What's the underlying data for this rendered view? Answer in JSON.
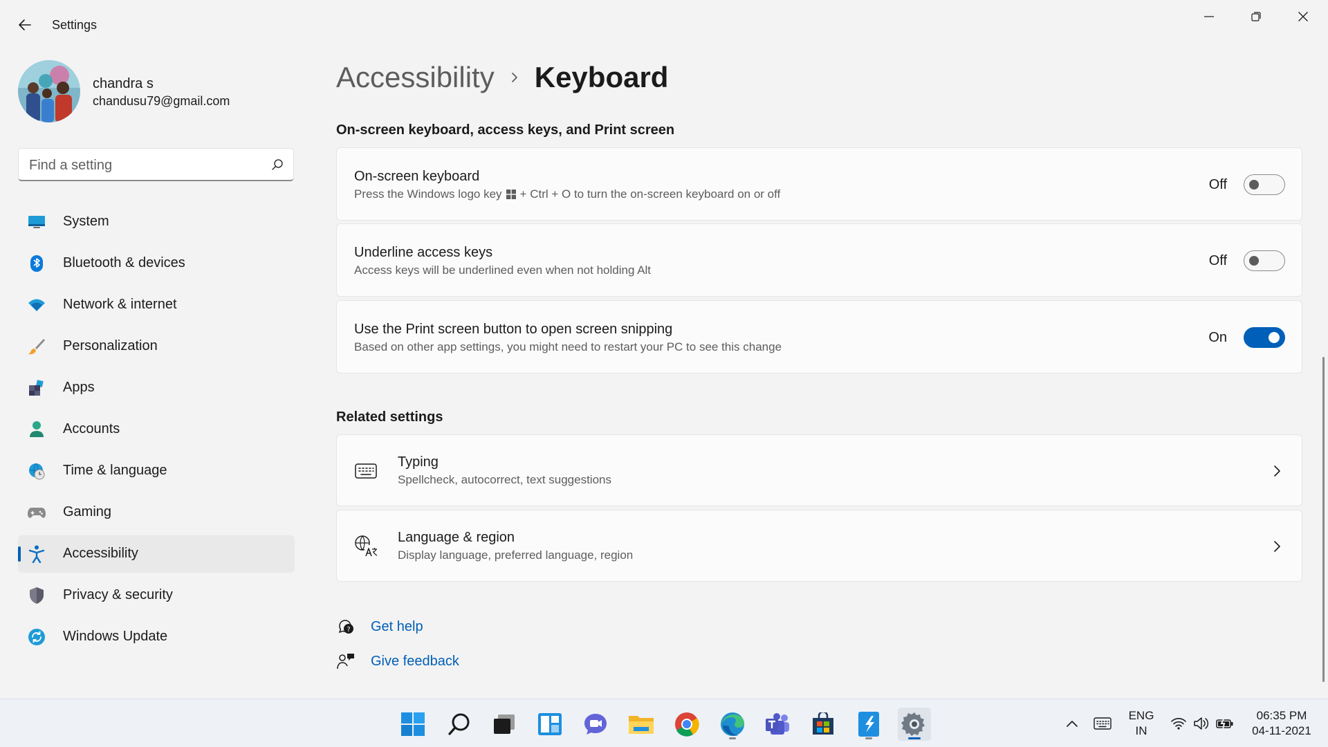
{
  "window": {
    "title": "Settings",
    "controls": [
      "minimize",
      "restore",
      "close"
    ]
  },
  "profile": {
    "name": "chandra s",
    "email": "chandusu79@gmail.com"
  },
  "search": {
    "placeholder": "Find a setting"
  },
  "sidebar": {
    "items": [
      {
        "label": "System",
        "icon": "system-icon"
      },
      {
        "label": "Bluetooth & devices",
        "icon": "bluetooth-icon"
      },
      {
        "label": "Network & internet",
        "icon": "wifi-icon"
      },
      {
        "label": "Personalization",
        "icon": "brush-icon"
      },
      {
        "label": "Apps",
        "icon": "apps-icon"
      },
      {
        "label": "Accounts",
        "icon": "accounts-icon"
      },
      {
        "label": "Time & language",
        "icon": "globe-clock-icon"
      },
      {
        "label": "Gaming",
        "icon": "gamepad-icon"
      },
      {
        "label": "Accessibility",
        "icon": "accessibility-icon",
        "active": true
      },
      {
        "label": "Privacy & security",
        "icon": "shield-icon"
      },
      {
        "label": "Windows Update",
        "icon": "update-icon"
      }
    ]
  },
  "breadcrumb": {
    "parent": "Accessibility",
    "current": "Keyboard"
  },
  "section1": {
    "title": "On-screen keyboard, access keys, and Print screen",
    "cards": [
      {
        "title": "On-screen keyboard",
        "desc_before": "Press the Windows logo key",
        "desc_after": "+ Ctrl + O to turn the on-screen keyboard on or off",
        "state": "Off",
        "on": false
      },
      {
        "title": "Underline access keys",
        "desc": "Access keys will be underlined even when not holding Alt",
        "state": "Off",
        "on": false
      },
      {
        "title": "Use the Print screen button to open screen snipping",
        "desc": "Based on other app settings, you might need to restart your PC to see this change",
        "state": "On",
        "on": true
      }
    ]
  },
  "related": {
    "title": "Related settings",
    "items": [
      {
        "title": "Typing",
        "desc": "Spellcheck, autocorrect, text suggestions",
        "icon": "keyboard-icon"
      },
      {
        "title": "Language & region",
        "desc": "Display language, preferred language, region",
        "icon": "language-icon"
      }
    ]
  },
  "help": {
    "get_help": "Get help",
    "give_feedback": "Give feedback"
  },
  "taskbar": {
    "apps": [
      "start-icon",
      "search-icon",
      "task-view-icon",
      "widgets-icon",
      "chat-icon",
      "file-explorer-icon",
      "chrome-icon",
      "edge-icon",
      "teams-icon",
      "store-icon",
      "vscode-icon",
      "settings-icon"
    ],
    "lang_line1": "ENG",
    "lang_line2": "IN",
    "time": "06:35 PM",
    "date": "04-11-2021"
  },
  "colors": {
    "accent": "#005fb8",
    "background": "#f3f3f3",
    "card": "#fbfbfb"
  }
}
